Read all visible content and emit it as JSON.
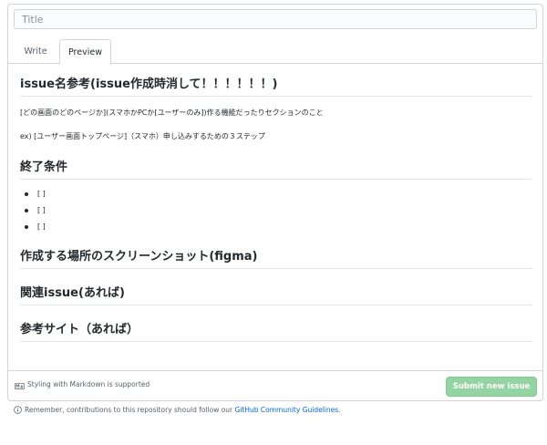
{
  "title_input": {
    "placeholder": "Title",
    "value": ""
  },
  "tabs": [
    {
      "label": "Write",
      "active": false
    },
    {
      "label": "Preview",
      "active": true
    }
  ],
  "preview": {
    "heading1": "issue名参考(issue作成時消して！！！！！！)",
    "para1": "[どの画面のどのページか](スマホかPCか[ユーザーのみ])作る機能だったりセクションのこと",
    "para2": "ex) [ユーザー画面トップページ]（スマホ）申し込みするための３ステップ",
    "heading2": "終了条件",
    "checklist": [
      "[ ]",
      "[ ]",
      "[ ]"
    ],
    "heading3": "作成する場所のスクリーンショット(figma)",
    "heading4": "関連issue(あれば)",
    "heading5": "参考サイト（あれば）"
  },
  "footer": {
    "markdown_icon": "markdown-icon",
    "markdown_text": "Styling with Markdown is supported",
    "submit_label": "Submit new issue",
    "submit_color": "#94d3a2"
  },
  "note": {
    "info_icon": "info-icon",
    "text": "Remember, contributions to this repository should follow our",
    "link_text": "GitHub Community Guidelines",
    "end": "."
  }
}
